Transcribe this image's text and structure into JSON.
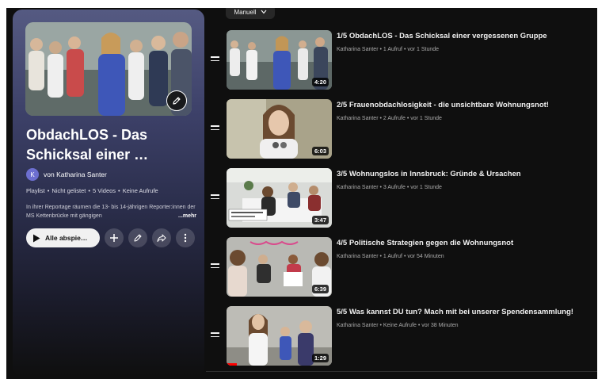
{
  "playlist": {
    "title": "ObdachLOS - Das Schicksal einer …",
    "owner_initial": "K",
    "owner": "von Katharina Santer",
    "meta": [
      "Playlist",
      "Nicht gelistet",
      "5 Videos",
      "Keine Aufrufe"
    ],
    "description": "In ihrer Reportage räumen die 13- bis 14-jährigen Reporter:innen der MS Kettenbrücke mit gängigen",
    "more_label": "...mehr",
    "play_all_label": "Alle abspie…"
  },
  "sort": {
    "label": "Manuell"
  },
  "videos": [
    {
      "title": "1/5 ObdachLOS - Das Schicksal einer vergessenen Gruppe",
      "meta": "Katharina Santer • 1 Aufruf • vor 1 Stunde",
      "duration": "4:20"
    },
    {
      "title": "2/5 Frauenobdachlosigkeit - die unsichtbare Wohnungsnot!",
      "meta": "Katharina Santer • 2 Aufrufe • vor 1 Stunde",
      "duration": "6:03"
    },
    {
      "title": "3/5 Wohnungslos in Innsbruck: Gründe & Ursachen",
      "meta": "Katharina Santer • 3 Aufrufe • vor 1 Stunde",
      "duration": "3:47"
    },
    {
      "title": "4/5 Politische Strategien gegen die Wohnungsnot",
      "meta": "Katharina Santer • 1 Aufruf • vor 54 Minuten",
      "duration": "6:39"
    },
    {
      "title": "5/5 Was kannst DU tun? Mach mit bei unserer Spendensammlung!",
      "meta": "Katharina Santer • Keine Aufrufe • vor 38 Minuten",
      "duration": "1:29",
      "watched_fraction": 0.1
    }
  ],
  "icons": [
    "pencil-icon",
    "play-icon",
    "plus-icon",
    "share-icon",
    "more-vert-icon",
    "chevron-down-icon",
    "drag-handle-icon"
  ],
  "colors": {
    "accent": "#ff0000",
    "background": "#0f0f0f",
    "panel_top": "#555a82"
  }
}
